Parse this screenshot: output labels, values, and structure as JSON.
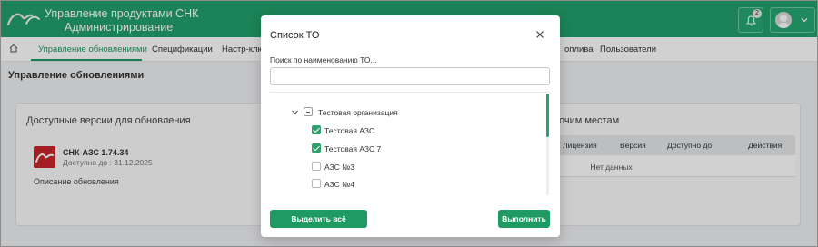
{
  "header": {
    "title": "Управление продуктами СНК",
    "subtitle": "Администрирование",
    "logo_text": "СНК",
    "notification_count": "2",
    "brand_color": "#22a06b"
  },
  "nav": {
    "items": [
      {
        "label": "Управление обновлениями",
        "active": true
      },
      {
        "label": "Спецификации"
      },
      {
        "label": "Настр-клю"
      },
      {
        "label": "оплива"
      },
      {
        "label": "Пользователи"
      }
    ]
  },
  "page": {
    "title": "Управление обновлениями"
  },
  "versions": {
    "title": "Доступные версии для обновления",
    "product_name": "СНК-АЗС 1.74.34",
    "available_until": "Доступно до : 31.12.2025",
    "description": "Описание обновления"
  },
  "places": {
    "title": "очим местам",
    "columns": [
      "Лицензия",
      "Версия",
      "Доступно до",
      "Действия"
    ],
    "empty_text": "Нет данных"
  },
  "modal": {
    "title": "Список ТО",
    "search_label": "Поиск по наименованию ТО...",
    "search_value": "",
    "tree": {
      "root": {
        "label": "Тестовая организация",
        "state": "partial",
        "expanded": true
      },
      "children": [
        {
          "label": "Тестовая АЗС",
          "state": "checked"
        },
        {
          "label": "Тестовая АЗС 7",
          "state": "checked"
        },
        {
          "label": "АЗС №3",
          "state": "unchecked"
        },
        {
          "label": "АЗС №4",
          "state": "unchecked"
        }
      ]
    },
    "select_all_label": "Выделить всё",
    "run_label": "Выполнить"
  }
}
